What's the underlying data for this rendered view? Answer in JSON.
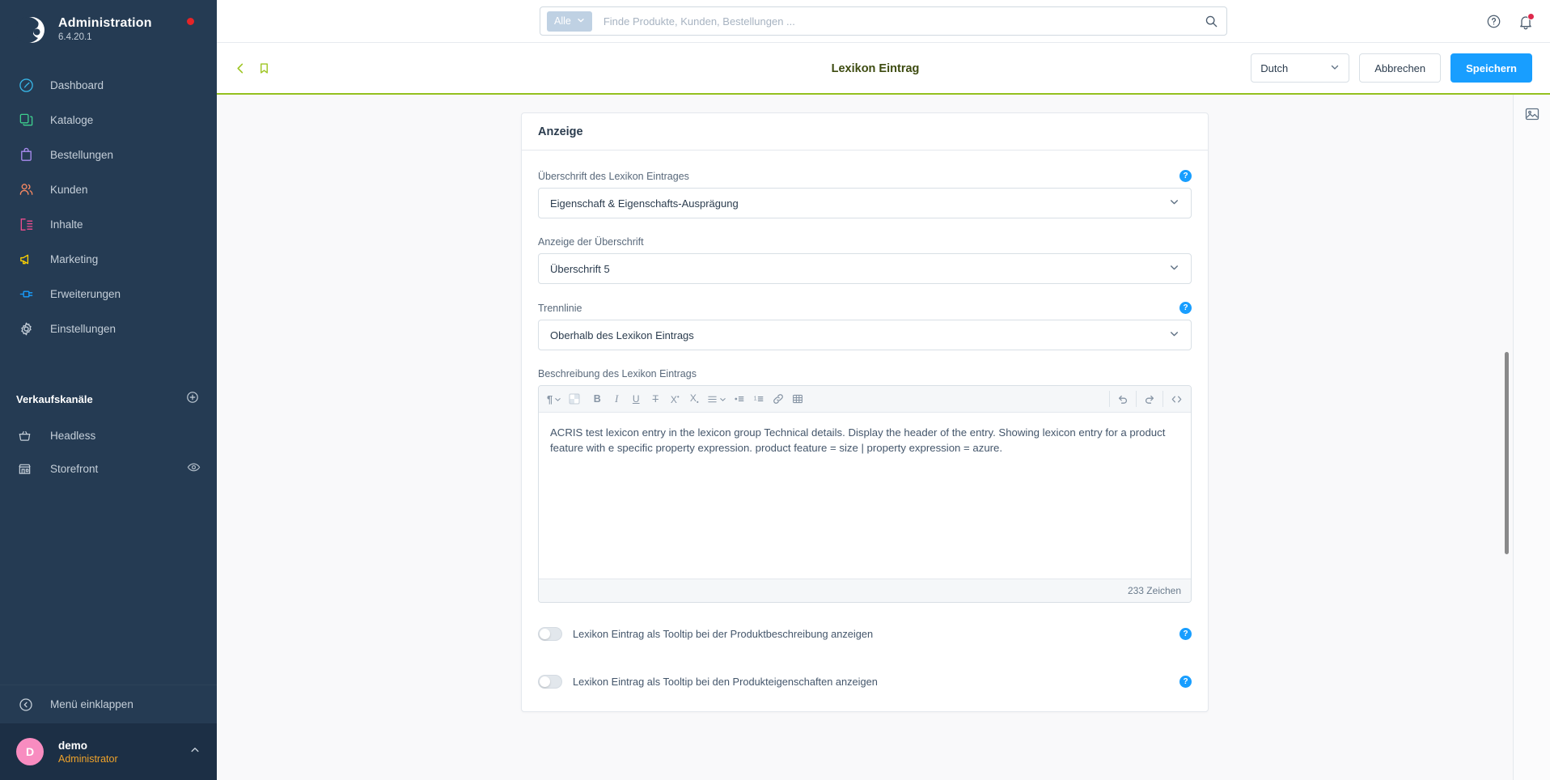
{
  "sidebar": {
    "brand": {
      "title": "Administration",
      "version": "6.4.20.1",
      "logo_icon": "shopware-logo-icon",
      "status_dot_color": "#e52427"
    },
    "items": [
      {
        "label": "Dashboard",
        "icon": "dashboard-icon",
        "color": "#37b5e6"
      },
      {
        "label": "Kataloge",
        "icon": "catalog-icon",
        "color": "#3ecf8e"
      },
      {
        "label": "Bestellungen",
        "icon": "orders-bag-icon",
        "color": "#a98cf0"
      },
      {
        "label": "Kunden",
        "icon": "customers-icon",
        "color": "#f88962"
      },
      {
        "label": "Inhalte",
        "icon": "content-icon",
        "color": "#ef4d8f"
      },
      {
        "label": "Marketing",
        "icon": "megaphone-icon",
        "color": "#ffd300"
      },
      {
        "label": "Erweiterungen",
        "icon": "plugin-icon",
        "color": "#189eff"
      },
      {
        "label": "Einstellungen",
        "icon": "gear-icon",
        "color": "#c5cfd9"
      }
    ],
    "sales_channels": {
      "title": "Verkaufskanäle",
      "add_icon": "plus-circle-icon",
      "items": [
        {
          "label": "Headless",
          "icon": "basket-icon",
          "trailing_icon": ""
        },
        {
          "label": "Storefront",
          "icon": "storefront-icon",
          "trailing_icon": "eye-icon"
        }
      ]
    },
    "collapse": {
      "label": "Menü einklappen",
      "icon": "chevron-left-circle-icon"
    },
    "user": {
      "initial": "D",
      "name": "demo",
      "role": "Administrator",
      "caret_icon": "chevron-up-icon",
      "avatar_color": "#f88cc0"
    }
  },
  "topbar": {
    "search": {
      "scope_label": "Alle",
      "scope_caret_icon": "chevron-down-icon",
      "placeholder": "Finde Produkte, Kunden, Bestellungen ...",
      "value": "",
      "search_icon": "search-icon"
    },
    "help_icon": "help-circle-icon",
    "notifications_icon": "bell-icon",
    "notification_badge_color": "#de294c"
  },
  "smartbar": {
    "back_icon": "chevron-left-icon",
    "bookmark_icon": "bookmark-icon",
    "title": "Lexikon Eintrag",
    "title_highlight_color": "#ffe600",
    "language": {
      "value": "Dutch",
      "caret_icon": "chevron-down-icon"
    },
    "cancel_label": "Abbrechen",
    "save_label": "Speichern",
    "accent_color": "#94c11f",
    "primary_color": "#189eff"
  },
  "card": {
    "title": "Anzeige",
    "fields": [
      {
        "label": "Überschrift des Lexikon Eintrages",
        "value": "Eigenschaft & Eigenschafts-Ausprägung",
        "has_help": true,
        "caret_icon": "chevron-down-icon"
      },
      {
        "label": "Anzeige der Überschrift",
        "value": "Überschrift 5",
        "has_help": false,
        "caret_icon": "chevron-down-icon"
      },
      {
        "label": "Trennlinie",
        "value": "Oberhalb des Lexikon Eintrags",
        "has_help": true,
        "caret_icon": "chevron-down-icon"
      }
    ],
    "editor": {
      "label": "Beschreibung des Lexikon Eintrags",
      "toolbar_left": [
        {
          "icon": "paragraph-format-icon",
          "glyph": "¶",
          "caret": true
        },
        {
          "icon": "text-color-icon",
          "glyph": "",
          "caret": false
        },
        {
          "icon": "bold-icon",
          "glyph": "B",
          "caret": false
        },
        {
          "icon": "italic-icon",
          "glyph": "I",
          "caret": false
        },
        {
          "icon": "underline-icon",
          "glyph": "U",
          "caret": false
        },
        {
          "icon": "strikethrough-icon",
          "glyph": "S",
          "caret": false
        },
        {
          "icon": "superscript-icon",
          "glyph": "X",
          "caret": false
        },
        {
          "icon": "subscript-icon",
          "glyph": "X",
          "caret": false
        },
        {
          "icon": "align-icon",
          "glyph": "",
          "caret": true
        },
        {
          "icon": "bullet-list-icon",
          "glyph": "",
          "caret": false
        },
        {
          "icon": "ordered-list-icon",
          "glyph": "",
          "caret": false
        },
        {
          "icon": "link-icon",
          "glyph": "",
          "caret": false
        },
        {
          "icon": "table-icon",
          "glyph": "",
          "caret": false
        }
      ],
      "toolbar_right": [
        {
          "icon": "undo-icon"
        },
        {
          "icon": "redo-icon"
        },
        {
          "icon": "code-view-icon"
        }
      ],
      "content": "ACRIS test lexicon entry in the lexicon group Technical details. Display the header of the entry. Showing lexicon entry for a product feature with e specific property expression. product feature = size | property expression = azure.",
      "char_count": "233 Zeichen"
    },
    "switches": [
      {
        "label": "Lexikon Eintrag als Tooltip bei der Produktbeschreibung anzeigen",
        "on": false,
        "has_help": true
      },
      {
        "label": "Lexikon Eintrag als Tooltip bei den Produkteigenschaften anzeigen",
        "on": false,
        "has_help": true
      }
    ]
  },
  "right_rail": {
    "items": [
      {
        "icon": "media-image-icon"
      }
    ]
  },
  "help_badge_glyph": "?"
}
